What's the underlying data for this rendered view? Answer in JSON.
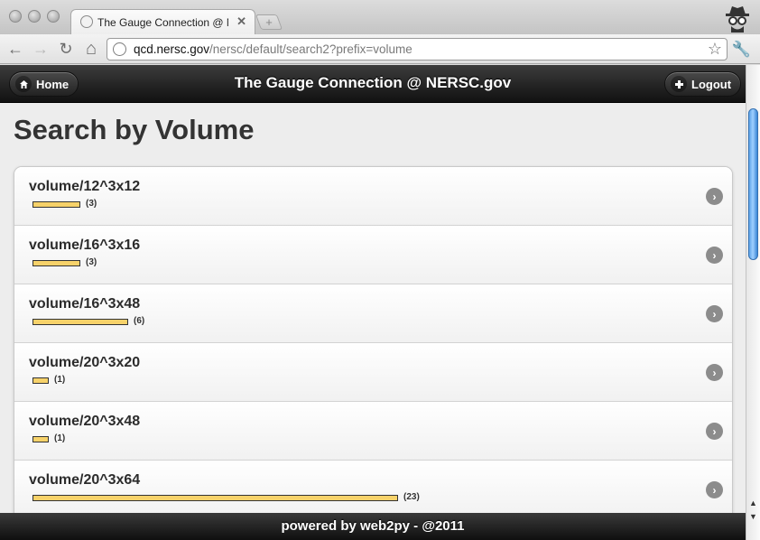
{
  "browser": {
    "tab_title": "The Gauge Connection @ NERSC.gov",
    "tab_close": "✕",
    "new_tab": "+",
    "url_host": "qcd.nersc.gov",
    "url_path": "/nersc/default/search2?prefix=volume",
    "back_glyph": "←",
    "forward_glyph": "→",
    "reload_glyph": "↻",
    "home_glyph": "⌂",
    "star_glyph": "☆",
    "wrench_glyph": "🔧"
  },
  "header": {
    "title": "The Gauge Connection @ NERSC.gov",
    "home_label": "Home",
    "logout_label": "Logout"
  },
  "page": {
    "title": "Search by Volume"
  },
  "items": [
    {
      "label": "volume/12^3x12",
      "count": 3,
      "count_text": "(3)"
    },
    {
      "label": "volume/16^3x16",
      "count": 3,
      "count_text": "(3)"
    },
    {
      "label": "volume/16^3x48",
      "count": 6,
      "count_text": "(6)"
    },
    {
      "label": "volume/20^3x20",
      "count": 1,
      "count_text": "(1)"
    },
    {
      "label": "volume/20^3x48",
      "count": 1,
      "count_text": "(1)"
    },
    {
      "label": "volume/20^3x64",
      "count": 23,
      "count_text": "(23)"
    }
  ],
  "footer": {
    "text": "powered by web2py - @2011"
  },
  "colors": {
    "bar_fill": "#f7d26a",
    "header_bg": "#1a1a1a",
    "scroll_thumb": "#5ea3e8"
  }
}
